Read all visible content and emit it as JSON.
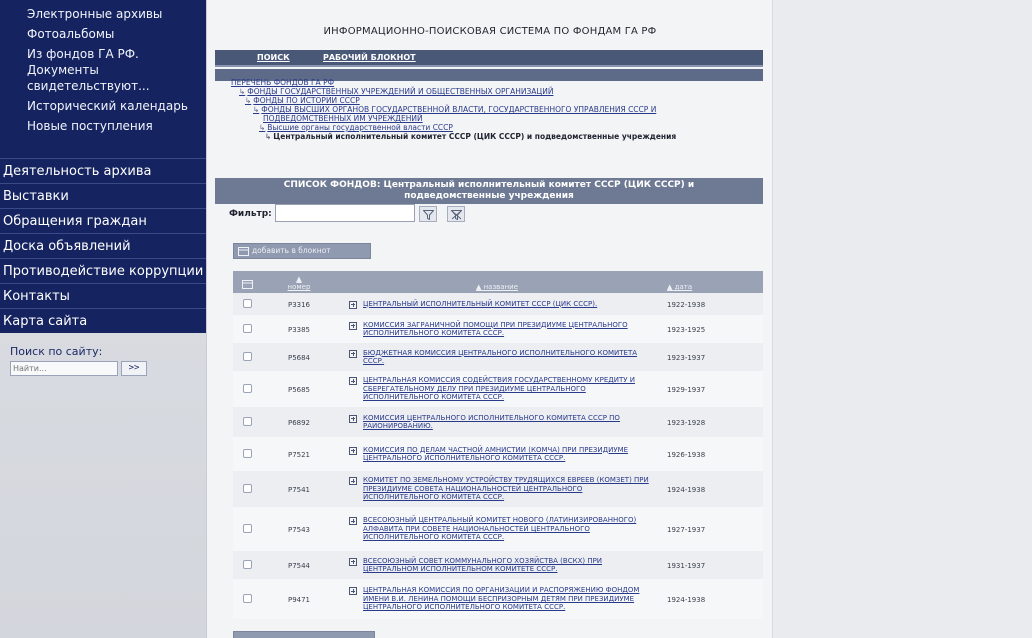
{
  "sidebar": {
    "sub_items": [
      {
        "label": "Электронные архивы"
      },
      {
        "label": "Фотоальбомы"
      },
      {
        "label": "Из фондов ГА РФ. Документы свидетельствуют..."
      },
      {
        "label": "Исторический календарь"
      },
      {
        "label": "Новые поступления"
      }
    ],
    "main_items": [
      {
        "label": "Деятельность архива"
      },
      {
        "label": "Выставки"
      },
      {
        "label": "Обращения граждан"
      },
      {
        "label": "Доска объявлений"
      },
      {
        "label": "Противодействие коррупции"
      },
      {
        "label": "Контакты"
      },
      {
        "label": "Карта сайта"
      }
    ],
    "search": {
      "label": "Поиск по сайту:",
      "placeholder": "Найти...",
      "go_label": ">>"
    }
  },
  "header": {
    "system_title": "ИНФОРМАЦИОННО-ПОИСКОВАЯ СИСТЕМА ПО ФОНДАМ ГА РФ",
    "nav": {
      "search": "ПОИСК",
      "notebook": "РАБОЧИЙ БЛОКНОТ"
    }
  },
  "breadcrumb": {
    "items": [
      "ПЕРЕЧЕНЬ ФОНДОВ ГА РФ",
      "ФОНДЫ ГОСУДАРСТВЕННЫХ УЧРЕЖДЕНИЙ И ОБЩЕСТВЕННЫХ ОРГАНИЗАЦИЙ",
      "ФОНДЫ ПО ИСТОРИИ СССР",
      "ФОНДЫ ВЫСШИХ ОРГАНОВ ГОСУДАРСТВЕННОЙ ВЛАСТИ, ГОСУДАРСТВЕННОГО УПРАВЛЕНИЯ СССР И",
      "ПОДВЕДОМСТВЕННЫХ ИМ УЧРЕЖДЕНИЙ",
      "Высшие органы государственной власти СССР"
    ],
    "current": "Центральный исполнительный комитет СССР (ЦИК СССР) и подведомственные учреждения"
  },
  "funds_list": {
    "title": "СПИСОК ФОНДОВ: Центральный исполнительный комитет СССР (ЦИК СССР) и подведомственные учреждения",
    "filter_label": "Фильтр:",
    "filter_value": "",
    "add_to_notebook": "добавить в блокнот",
    "columns": {
      "number": "номер",
      "name": "название",
      "date": "дата"
    },
    "rows": [
      {
        "number": "Р3316",
        "name": "ЦЕНТРАЛЬНЫЙ ИСПОЛНИТЕЛЬНЫЙ КОМИТЕТ СССР (ЦИК СССР).",
        "date": "1922-1938"
      },
      {
        "number": "Р3385",
        "name": "КОМИССИЯ ЗАГРАНИЧНОЙ ПОМОЩИ ПРИ ПРЕЗИДИУМЕ ЦЕНТРАЛЬНОГО ИСПОЛНИТЕЛЬНОГО КОМИТЕТА СССР.",
        "date": "1923-1925"
      },
      {
        "number": "Р5684",
        "name": "БЮДЖЕТНАЯ КОМИССИЯ ЦЕНТРАЛЬНОГО ИСПОЛНИТЕЛЬНОГО КОМИТЕТА СССР.",
        "date": "1923-1937"
      },
      {
        "number": "Р5685",
        "name": "ЦЕНТРАЛЬНАЯ КОМИССИЯ СОДЕЙСТВИЯ ГОСУДАРСТВЕННОМУ КРЕДИТУ И СБЕРЕГАТЕЛЬНОМУ ДЕЛУ ПРИ ПРЕЗИДИУМЕ ЦЕНТРАЛЬНОГО ИСПОЛНИТЕЛЬНОГО КОМИТЕТА СССР.",
        "date": "1929-1937"
      },
      {
        "number": "Р6892",
        "name": "КОМИССИЯ ЦЕНТРАЛЬНОГО ИСПОЛНИТЕЛЬНОГО КОМИТЕТА СССР ПО РАЙОНИРОВАНИЮ.",
        "date": "1923-1928"
      },
      {
        "number": "Р7521",
        "name": "КОМИССИЯ ПО ДЕЛАМ ЧАСТНОЙ АМНИСТИИ (КОМЧА) ПРИ ПРЕЗИДИУМЕ ЦЕНТРАЛЬНОГО ИСПОЛНИТЕЛЬНОГО КОМИТЕТА СССР.",
        "date": "1926-1938"
      },
      {
        "number": "Р7541",
        "name": "КОМИТЕТ ПО ЗЕМЕЛЬНОМУ УСТРОЙСТВУ ТРУДЯЩИХСЯ ЕВРЕЕВ (КОМЗЕТ) ПРИ ПРЕЗИДИУМЕ СОВЕТА НАЦИОНАЛЬНОСТЕЙ ЦЕНТРАЛЬНОГО ИСПОЛНИТЕЛЬНОГО КОМИТЕТА СССР.",
        "date": "1924-1938"
      },
      {
        "number": "Р7543",
        "name": "ВСЕСОЮЗНЫЙ ЦЕНТРАЛЬНЫЙ КОМИТЕТ НОВОГО (ЛАТИНИЗИРОВАННОГО) АЛФАВИТА ПРИ СОВЕТЕ НАЦИОНАЛЬНОСТЕЙ ЦЕНТРАЛЬНОГО ИСПОЛНИТЕЛЬНОГО КОМИТЕТА СССР.",
        "date": "1927-1937"
      },
      {
        "number": "Р7544",
        "name": "ВСЕСОЮЗНЫЙ СОВЕТ КОММУНАЛЬНОГО ХОЗЯЙСТВА (ВСКХ) ПРИ ЦЕНТРАЛЬНОМ ИСПОЛНИТЕЛЬНОМ КОМИТЕТЕ СССР.",
        "date": "1931-1937"
      },
      {
        "number": "Р9471",
        "name": "ЦЕНТРАЛЬНАЯ КОМИССИЯ ПО ОРГАНИЗАЦИИ И РАСПОРЯЖЕНИЮ ФОНДОМ ИМЕНИ В.И. ЛЕНИНА ПОМОЩИ БЕСПРИЗОРНЫМ ДЕТЯМ ПРИ ПРЕЗИДИУМЕ ЦЕНТРАЛЬНОГО ИСПОЛНИТЕЛЬНОГО КОМИТЕТА СССР.",
        "date": "1924-1938"
      }
    ]
  }
}
